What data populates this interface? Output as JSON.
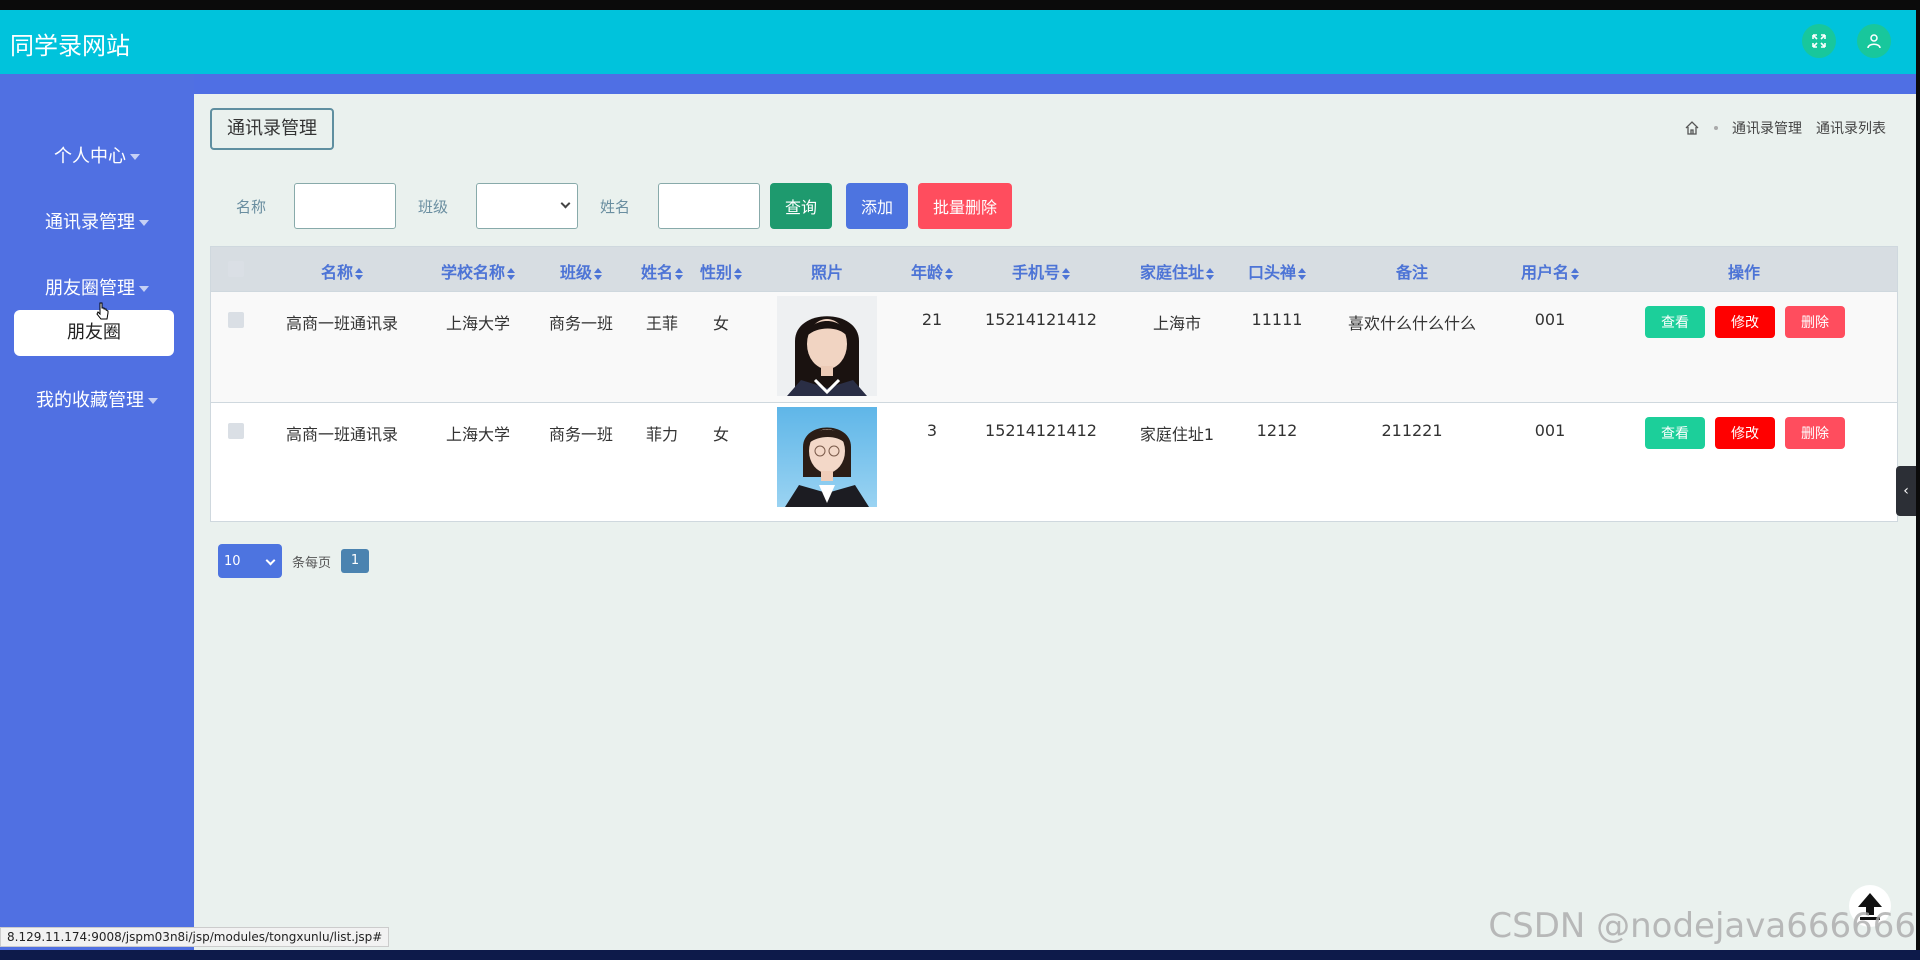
{
  "app": {
    "title": "同学录网站"
  },
  "sidebar": {
    "items": [
      {
        "label": "个人中心"
      },
      {
        "label": "通讯录管理"
      },
      {
        "label": "朋友圈管理"
      },
      {
        "label": "我的收藏管理"
      }
    ],
    "active_submenu": "朋友圈"
  },
  "main": {
    "title": "通讯录管理",
    "breadcrumb": [
      "通讯录管理",
      "通讯录列表"
    ]
  },
  "search": {
    "name_label": "名称",
    "class_label": "班级",
    "person_label": "姓名",
    "query_btn": "查询",
    "add_btn": "添加",
    "batch_delete_btn": "批量删除"
  },
  "table": {
    "headers": [
      "名称",
      "学校名称",
      "班级",
      "姓名",
      "性别",
      "照片",
      "年龄",
      "手机号",
      "家庭住址",
      "口头禅",
      "备注",
      "用户名",
      "操作"
    ],
    "rows": [
      {
        "name": "高商一班通讯录",
        "school": "上海大学",
        "class": "商务一班",
        "person": "王菲",
        "gender": "女",
        "age": "21",
        "phone": "15214121412",
        "address": "上海市",
        "catchphrase": "11111",
        "remark": "喜欢什么什么什么",
        "username": "001"
      },
      {
        "name": "高商一班通讯录",
        "school": "上海大学",
        "class": "商务一班",
        "person": "菲力",
        "gender": "女",
        "age": "3",
        "phone": "15214121412",
        "address": "家庭住址1",
        "catchphrase": "1212",
        "remark": "211221",
        "username": "001"
      }
    ],
    "actions": {
      "view": "查看",
      "edit": "修改",
      "delete": "删除"
    }
  },
  "pager": {
    "page_size": "10",
    "per_page_label": "条每页",
    "current_page": "1"
  },
  "status_bar": {
    "url": "8.129.11.174:9008/jspm03n8i/jsp/modules/tongxunlu/list.jsp#"
  },
  "watermark": "CSDN @nodejava666666",
  "colors": {
    "topbar": "#00c3dc",
    "sidebar": "#5070e2",
    "view": "#1ccf9a",
    "edit": "#ff0000",
    "delete": "#ff4d5e",
    "query": "#1e9a6e",
    "add": "#4d74e0",
    "batch_delete": "#ff4d5e"
  }
}
